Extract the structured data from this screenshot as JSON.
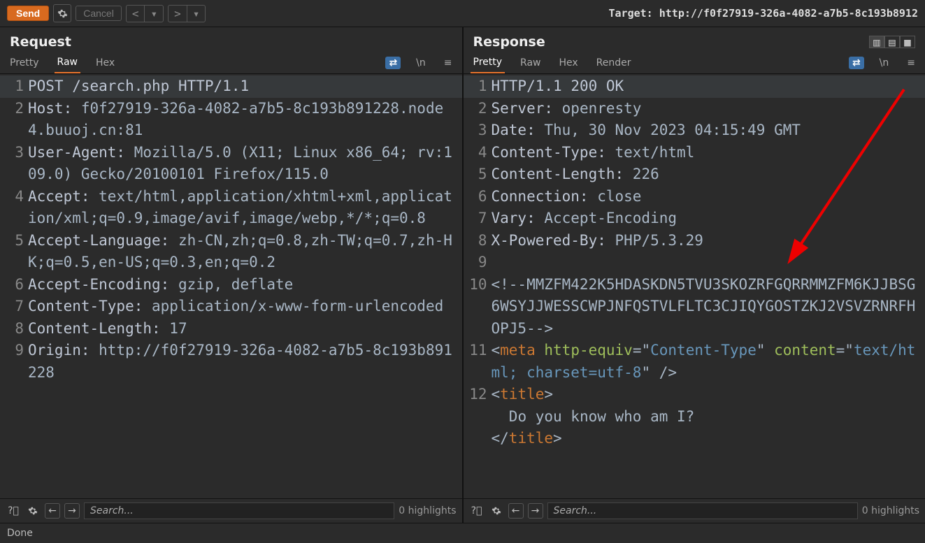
{
  "toolbar": {
    "send_label": "Send",
    "cancel_label": "Cancel",
    "target_label": "Target: http://f0f27919-326a-4082-a7b5-8c193b8912"
  },
  "request": {
    "title": "Request",
    "tabs": {
      "pretty": "Pretty",
      "raw": "Raw",
      "hex": "Hex"
    },
    "lines": [
      {
        "n": 1,
        "segments": [
          [
            "mtd",
            "POST"
          ],
          [
            "val",
            " "
          ],
          [
            "mtd",
            "/search.php"
          ],
          [
            "val",
            " "
          ],
          [
            "http",
            "HTTP/1.1"
          ]
        ],
        "hilite": true
      },
      {
        "n": 2,
        "segments": [
          [
            "hdr",
            "Host:"
          ],
          [
            "val",
            " f0f27919-326a-4082-a7b5-8c193b891228.node4.buuoj.cn:81"
          ]
        ]
      },
      {
        "n": 3,
        "segments": [
          [
            "hdr",
            "User-Agent:"
          ],
          [
            "val",
            " Mozilla/5.0 (X11; Linux x86_64; rv:109.0) Gecko/20100101 Firefox/115.0"
          ]
        ]
      },
      {
        "n": 4,
        "segments": [
          [
            "hdr",
            "Accept:"
          ],
          [
            "val",
            " text/html,application/xhtml+xml,application/xml;q=0.9,image/avif,image/webp,*/*;q=0.8"
          ]
        ]
      },
      {
        "n": 5,
        "segments": [
          [
            "hdr",
            "Accept-Language:"
          ],
          [
            "val",
            " zh-CN,zh;q=0.8,zh-TW;q=0.7,zh-HK;q=0.5,en-US;q=0.3,en;q=0.2"
          ]
        ]
      },
      {
        "n": 6,
        "segments": [
          [
            "hdr",
            "Accept-Encoding:"
          ],
          [
            "val",
            " gzip, deflate"
          ]
        ]
      },
      {
        "n": 7,
        "segments": [
          [
            "hdr",
            "Content-Type:"
          ],
          [
            "val",
            " application/x-www-form-urlencoded"
          ]
        ]
      },
      {
        "n": 8,
        "segments": [
          [
            "hdr",
            "Content-Length:"
          ],
          [
            "val",
            " 17"
          ]
        ]
      },
      {
        "n": 9,
        "segments": [
          [
            "hdr",
            "Origin:"
          ],
          [
            "val",
            " http://f0f27919-326a-4082-a7b5-8c193b891228"
          ]
        ]
      }
    ],
    "search_placeholder": "Search...",
    "highlights": "0 highlights"
  },
  "response": {
    "title": "Response",
    "tabs": {
      "pretty": "Pretty",
      "raw": "Raw",
      "hex": "Hex",
      "render": "Render"
    },
    "lines": [
      {
        "n": 1,
        "segments": [
          [
            "http",
            "HTTP/1.1"
          ],
          [
            "val",
            " "
          ],
          [
            "mtd",
            "200 OK"
          ]
        ],
        "hilite": true
      },
      {
        "n": 2,
        "segments": [
          [
            "hdr",
            "Server:"
          ],
          [
            "val",
            " openresty"
          ]
        ]
      },
      {
        "n": 3,
        "segments": [
          [
            "hdr",
            "Date:"
          ],
          [
            "val",
            " Thu, 30 Nov 2023 04:15:49 GMT"
          ]
        ]
      },
      {
        "n": 4,
        "segments": [
          [
            "hdr",
            "Content-Type:"
          ],
          [
            "val",
            " text/html"
          ]
        ]
      },
      {
        "n": 5,
        "segments": [
          [
            "hdr",
            "Content-Length:"
          ],
          [
            "val",
            " 226"
          ]
        ]
      },
      {
        "n": 6,
        "segments": [
          [
            "hdr",
            "Connection:"
          ],
          [
            "val",
            " close"
          ]
        ]
      },
      {
        "n": 7,
        "segments": [
          [
            "hdr",
            "Vary:"
          ],
          [
            "val",
            " Accept-Encoding"
          ]
        ]
      },
      {
        "n": 8,
        "segments": [
          [
            "hdr",
            "X-Powered-By:"
          ],
          [
            "val",
            " PHP/5.3.29"
          ]
        ]
      },
      {
        "n": 9,
        "segments": []
      },
      {
        "n": 10,
        "segments": [
          [
            "tagc",
            "<!--"
          ],
          [
            "val",
            "MMZFM422K5HDASKDN5TVU3SKOZRFGQRRMMZFM6KJJBSG6WSYJJWESSCWPJNFQSTVLFLTC3CJIQYGOSTZKJ2VSVZRNRFHOPJ5"
          ],
          [
            "tagc",
            "-->"
          ]
        ]
      },
      {
        "n": 11,
        "segments": [
          [
            "tagc",
            "<"
          ],
          [
            "tagn",
            "meta"
          ],
          [
            "val",
            " "
          ],
          [
            "attrn",
            "http-equiv"
          ],
          [
            "tagc",
            "=\""
          ],
          [
            "attrv",
            "Content-Type"
          ],
          [
            "tagc",
            "\" "
          ],
          [
            "attrn",
            "content"
          ],
          [
            "tagc",
            "=\""
          ],
          [
            "attrv",
            "text/html; charset=utf-8"
          ],
          [
            "tagc",
            "\" />"
          ]
        ]
      },
      {
        "n": 12,
        "segments": [
          [
            "tagc",
            "<"
          ],
          [
            "tagn",
            "title"
          ],
          [
            "tagc",
            ">"
          ],
          [
            "val",
            "\n  Do you know who am I?\n"
          ],
          [
            "tagc",
            "</"
          ],
          [
            "tagn",
            "title"
          ],
          [
            "tagc",
            ">"
          ]
        ]
      }
    ],
    "search_placeholder": "Search...",
    "highlights": "0 highlights"
  },
  "status": "Done"
}
